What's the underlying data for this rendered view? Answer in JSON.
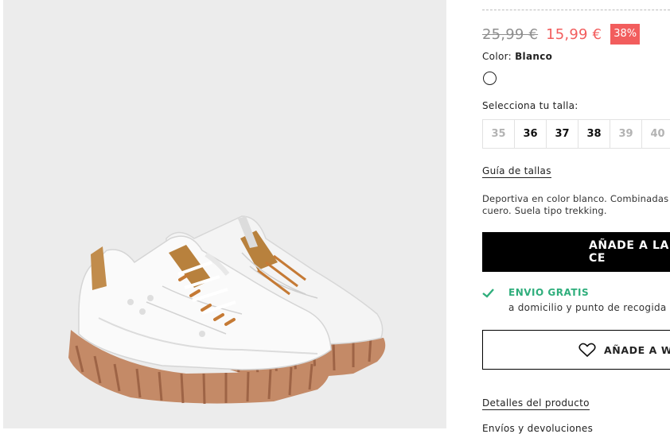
{
  "product": {
    "old_price": "25,99 €",
    "new_price": "15,99 €",
    "discount": "38%",
    "color_label": "Color:",
    "color_value": "Blanco",
    "size_label": "Selecciona tu talla:",
    "sizes": [
      {
        "label": "35",
        "available": false
      },
      {
        "label": "36",
        "available": true
      },
      {
        "label": "37",
        "available": true
      },
      {
        "label": "38",
        "available": true
      },
      {
        "label": "39",
        "available": false
      },
      {
        "label": "40",
        "available": false
      }
    ],
    "size_guide": "Guía de tallas",
    "description_line1": "Deportiva en color blanco. Combinadas co",
    "description_line2": "cuero. Suela tipo trekking."
  },
  "actions": {
    "add_to_cart": "AÑADE A LA CE",
    "wishlist": "AÑADE A WIS"
  },
  "shipping": {
    "title": "ENVIO GRATIS",
    "subtitle": "a domicilio y punto de recogida a",
    "icon": "check-icon"
  },
  "links": {
    "product_details": "Detalles del producto",
    "shipping_returns": "Envíos y devoluciones"
  },
  "colors": {
    "sale_red": "#f25d5d",
    "shipping_green": "#2fae7c",
    "image_background": "#ececec"
  }
}
